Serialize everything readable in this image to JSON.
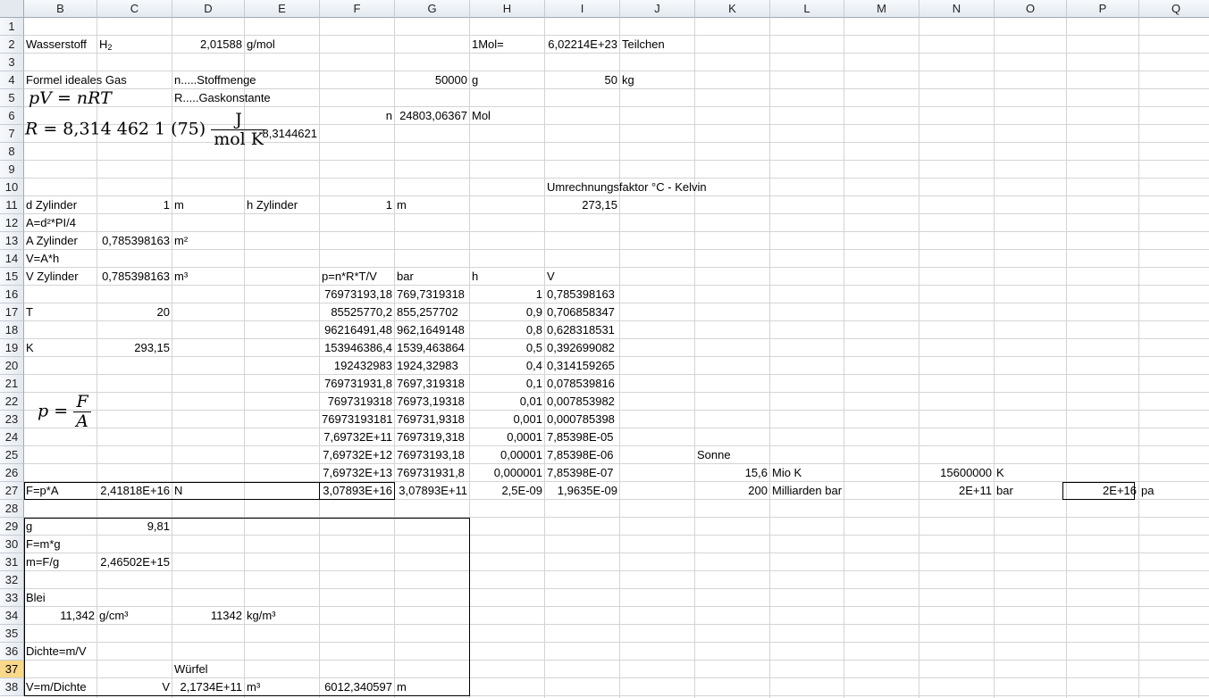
{
  "columns": [
    "B",
    "C",
    "D",
    "E",
    "F",
    "G",
    "H",
    "I",
    "J",
    "K",
    "L",
    "M",
    "N",
    "O",
    "P",
    "Q"
  ],
  "rows": [
    "1",
    "2",
    "3",
    "4",
    "5",
    "6",
    "7",
    "8",
    "9",
    "10",
    "11",
    "12",
    "13",
    "14",
    "15",
    "16",
    "17",
    "18",
    "19",
    "20",
    "21",
    "22",
    "23",
    "24",
    "25",
    "26",
    "27",
    "28",
    "29",
    "30",
    "31",
    "32",
    "33",
    "34",
    "35",
    "36",
    "37",
    "38"
  ],
  "active_row": "37",
  "cells": {
    "B2": "Wasserstoff",
    "C2_main": "H",
    "C2_sub": "2",
    "D2": "2,01588",
    "E2": "g/mol",
    "H2": "1Mol=",
    "I2": "6,02214E+23",
    "J2": "Teilchen",
    "B4": "Formel ideales Gas",
    "D4": "n.....Stoffmenge",
    "G4": "50000",
    "H4": "g",
    "I4": "50",
    "J4": "kg",
    "D5": "R.....Gaskonstante",
    "F6": "n",
    "G6": "24803,06367",
    "H6": "Mol",
    "E7": "8,3144621",
    "I10": "Umrechnungsfaktor °C - Kelvin",
    "B11": "d Zylinder",
    "C11": "1",
    "D11": "m",
    "E11": "h Zylinder",
    "F11": "1",
    "G11": "m",
    "I11": "273,15",
    "B12": "A=d²*PI/4",
    "B13": "A Zylinder",
    "C13": "0,785398163",
    "D13": "m²",
    "B14": "V=A*h",
    "B15": "V Zylinder",
    "C15": "0,785398163",
    "D15": "m³",
    "F15": "p=n*R*T/V",
    "G15": "bar",
    "H15": "h",
    "I15": "V",
    "B17": "T",
    "C17": "20",
    "B19": "K",
    "C19": "293,15",
    "K25": "Sonne",
    "K26": "15,6",
    "L26": "Mio K",
    "N26": "15600000",
    "O26": "K",
    "B27": "F=p*A",
    "C27": "2,41818E+16",
    "D27": "N",
    "F27": "3,07893E+16",
    "G27": "3,07893E+11",
    "H27": "2,5E-09",
    "I27": "1,9635E-09",
    "K27": "200",
    "L27": "Milliarden bar",
    "N27": "2E+11",
    "O27": "bar",
    "P27": "2E+16",
    "Q27": "pa",
    "B29": "g",
    "C29": "9,81",
    "B30": "F=m*g",
    "B31": "m=F/g",
    "C31": "2,46502E+15",
    "B33": "Blei",
    "B34": "11,342",
    "C34": "g/cm³",
    "D34": "11342",
    "E34": "kg/m³",
    "B36": "Dichte=m/V",
    "D37": "Würfel",
    "B38": "V=m/Dichte",
    "C38": "V",
    "D38": "2,1734E+11",
    "E38": "m³",
    "F38": "6012,340597",
    "G38": "m"
  },
  "table_rows_16_26": [
    {
      "F": "76973193,18",
      "G": "769,7319318",
      "H": "1",
      "I": "0,785398163"
    },
    {
      "F": "85525770,2",
      "G": "855,257702",
      "H": "0,9",
      "I": "0,706858347"
    },
    {
      "F": "96216491,48",
      "G": "962,1649148",
      "H": "0,8",
      "I": "0,628318531"
    },
    {
      "F": "153946386,4",
      "G": "1539,463864",
      "H": "0,5",
      "I": "0,392699082"
    },
    {
      "F": "192432983",
      "G": "1924,32983",
      "H": "0,4",
      "I": "0,314159265"
    },
    {
      "F": "769731931,8",
      "G": "7697,319318",
      "H": "0,1",
      "I": "0,078539816"
    },
    {
      "F": "7697319318",
      "G": "76973,19318",
      "H": "0,01",
      "I": "0,007853982"
    },
    {
      "F": "76973193181",
      "G": "769731,9318",
      "H": "0,001",
      "I": "0,000785398"
    },
    {
      "F": "7,69732E+11",
      "G": "7697319,318",
      "H": "0,0001",
      "I": "7,85398E-05"
    },
    {
      "F": "7,69732E+12",
      "G": "76973193,18",
      "H": "0,00001",
      "I": "7,85398E-06"
    },
    {
      "F": "7,69732E+13",
      "G": "769731931,8",
      "H": "0,000001",
      "I": "7,85398E-07"
    }
  ],
  "formulas": {
    "ideal_gas_p": "p",
    "ideal_gas_v": "V",
    "ideal_gas_eq": " = ",
    "ideal_gas_rhs": "nRT",
    "r_lhs": "R",
    "r_value": " = 8,314 462 1 (75) ",
    "r_num": "J",
    "r_den": "mol K",
    "p_lhs": "p",
    "p_eq": " = ",
    "p_num": "F",
    "p_den": "A"
  }
}
